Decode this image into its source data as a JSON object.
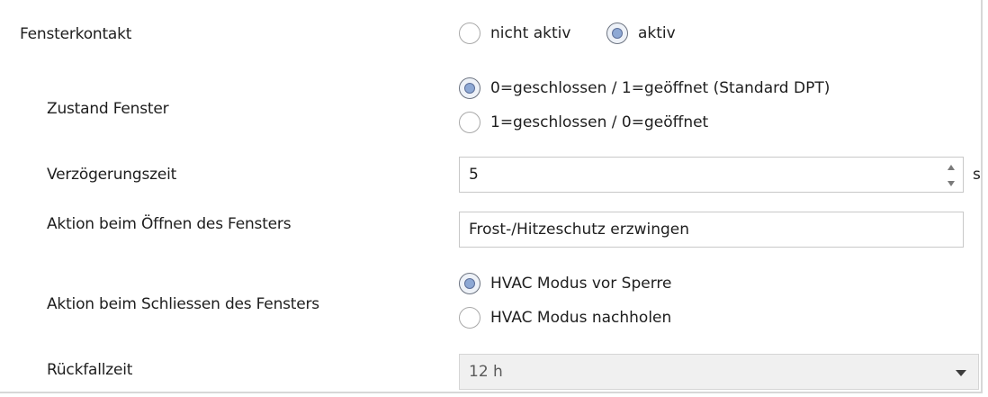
{
  "fensterkontakt": {
    "label": "Fensterkontakt",
    "options": [
      "nicht aktiv",
      "aktiv"
    ],
    "selected": "aktiv"
  },
  "zustand_fenster": {
    "label": "Zustand Fenster",
    "options": [
      "0=geschlossen / 1=geöffnet (Standard DPT)",
      "1=geschlossen / 0=geöffnet"
    ],
    "selected": "0=geschlossen / 1=geöffnet (Standard DPT)"
  },
  "verzoegerungszeit": {
    "label": "Verzögerungszeit",
    "value": "5",
    "unit": "s"
  },
  "aktion_oeffnen": {
    "label": "Aktion beim Öffnen des Fensters",
    "value": "Frost-/Hitzeschutz erzwingen"
  },
  "aktion_schliessen": {
    "label": "Aktion beim Schliessen des Fensters",
    "options": [
      "HVAC Modus vor Sperre",
      "HVAC Modus nachholen"
    ],
    "selected": "HVAC Modus vor Sperre"
  },
  "rueckfallzeit": {
    "label": "Rückfallzeit",
    "value": "12 h"
  },
  "colors": {
    "radio_selected_fill": "#8da8d4",
    "field_border": "#c8c8c8",
    "disabled_bg": "#f0f0f0"
  }
}
